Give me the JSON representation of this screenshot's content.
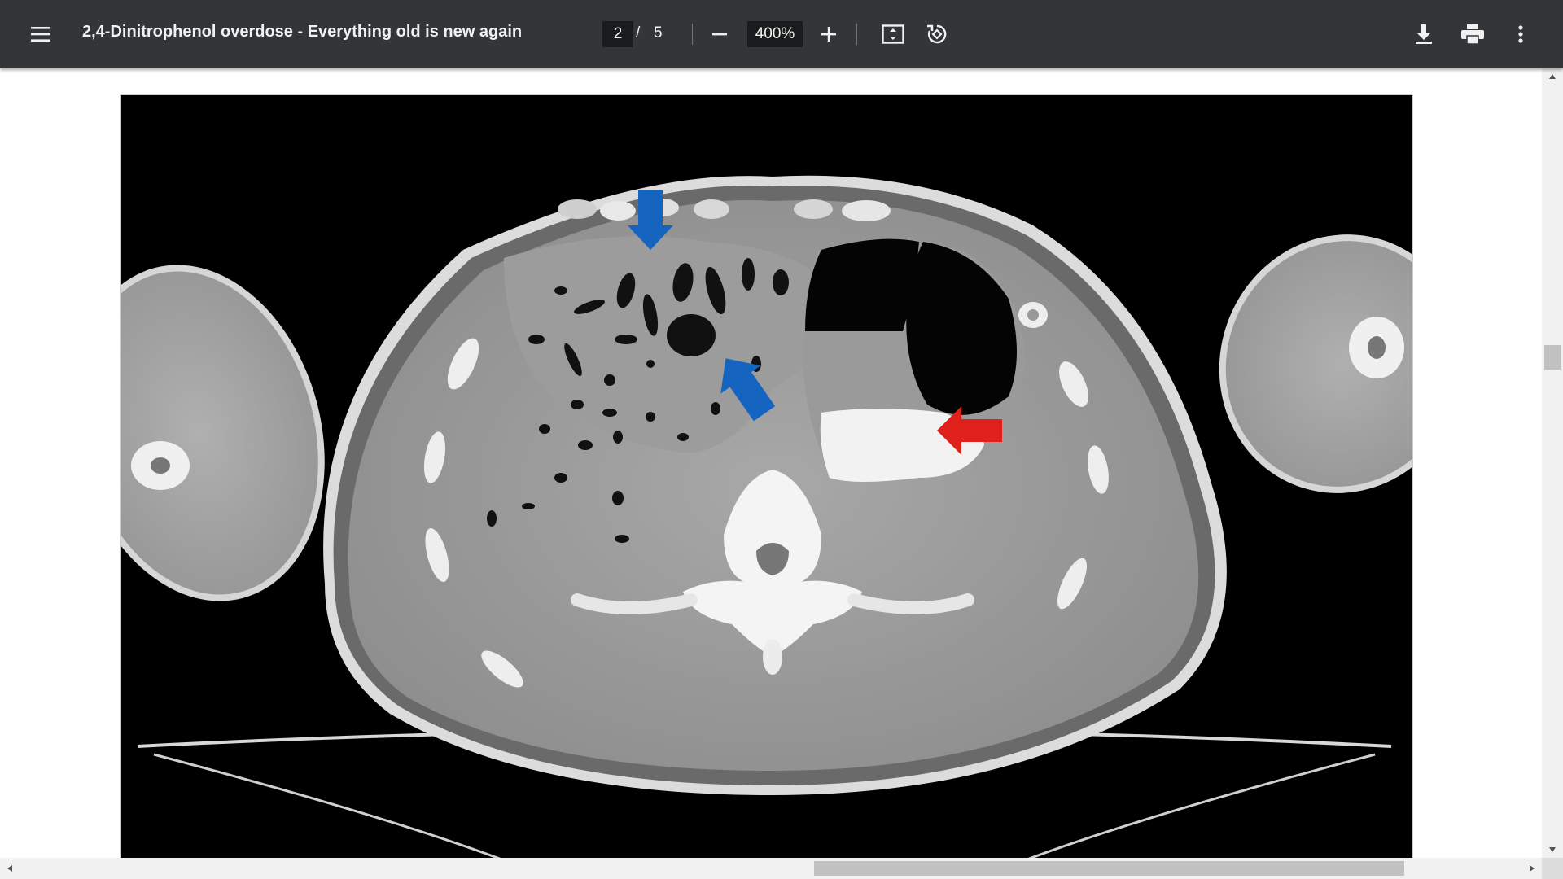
{
  "toolbar": {
    "menu_icon": "hamburger-menu-icon",
    "title": "2,4-Dinitrophenol overdose - Everything old is new again",
    "page_current": "2",
    "page_separator": "/",
    "page_total": "5",
    "zoom_level": "400%",
    "zoom_out_icon": "minus-icon",
    "zoom_in_icon": "plus-icon",
    "fit_icon": "fit-to-page-icon",
    "rotate_icon": "rotate-counterclockwise-icon",
    "download_icon": "download-icon",
    "print_icon": "print-icon",
    "more_icon": "more-vertical-icon"
  },
  "document": {
    "image": "axial CT scan of abdomen with blue and red arrows",
    "arrows": [
      {
        "color": "#1565c0",
        "name": "blue-arrow-down"
      },
      {
        "color": "#1565c0",
        "name": "blue-arrow-diagonal"
      },
      {
        "color": "#e0201b",
        "name": "red-arrow-left"
      }
    ]
  },
  "colors": {
    "toolbar_bg": "#323639",
    "viewer_bg": "#ffffff",
    "scroll_track": "#f1f1f1",
    "scroll_thumb": "#c1c1c1"
  }
}
